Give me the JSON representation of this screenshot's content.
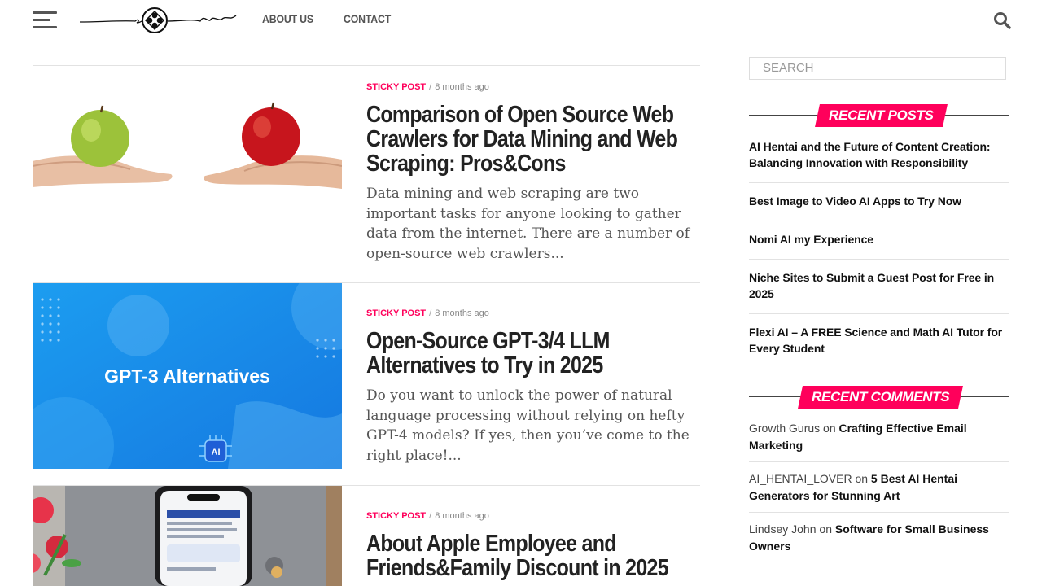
{
  "nav": {
    "items": [
      "ABOUT US",
      "CONTACT"
    ]
  },
  "posts": [
    {
      "sticky": "STICKY POST",
      "separator": "/",
      "date": "8 months ago",
      "title": "Comparison of Open Source Web Crawlers for Data Mining and Web Scraping: Pros&Cons",
      "excerpt": "Data mining and web scraping are two important tasks for anyone looking to gather data from the internet. There are a number of open-source web crawlers..."
    },
    {
      "sticky": "STICKY POST",
      "separator": "/",
      "date": "8 months ago",
      "title": "Open-Source GPT-3/4 LLM Alternatives to Try in 2025",
      "excerpt": "Do you want to unlock the power of natural language processing without relying on hefty GPT-4 models? If yes, then you’ve come to the right place!...",
      "image_text": "GPT-3 Alternatives",
      "image_badge": "AI"
    },
    {
      "sticky": "STICKY POST",
      "separator": "/",
      "date": "8 months ago",
      "title": "About Apple Employee and Friends&Family Discount in 2025"
    }
  ],
  "sidebar": {
    "search_placeholder": "SEARCH",
    "recent_posts_title": "RECENT POSTS",
    "recent_posts": [
      "AI Hentai and the Future of Content Creation: Balancing Innovation with Responsibility",
      "Best Image to Video AI Apps to Try Now",
      "Nomi AI my Experience",
      "Niche Sites to Submit a Guest Post for Free in 2025",
      "Flexi AI – A FREE Science and Math AI Tutor for Every Student"
    ],
    "recent_comments_title": "RECENT COMMENTS",
    "comments": [
      {
        "author": "Growth Gurus",
        "on": "on",
        "post": "Crafting Effective Email Marketing"
      },
      {
        "author": "AI_HENTAI_LOVER",
        "on": "on",
        "post": "5 Best AI Hentai Generators for Stunning Art"
      },
      {
        "author": "Lindsey John",
        "on": "on",
        "post": "Software for Small Business Owners"
      }
    ]
  },
  "colors": {
    "accent": "#ff005b",
    "text": "#222222",
    "muted": "#888888",
    "rule": "#e2e2e2"
  }
}
